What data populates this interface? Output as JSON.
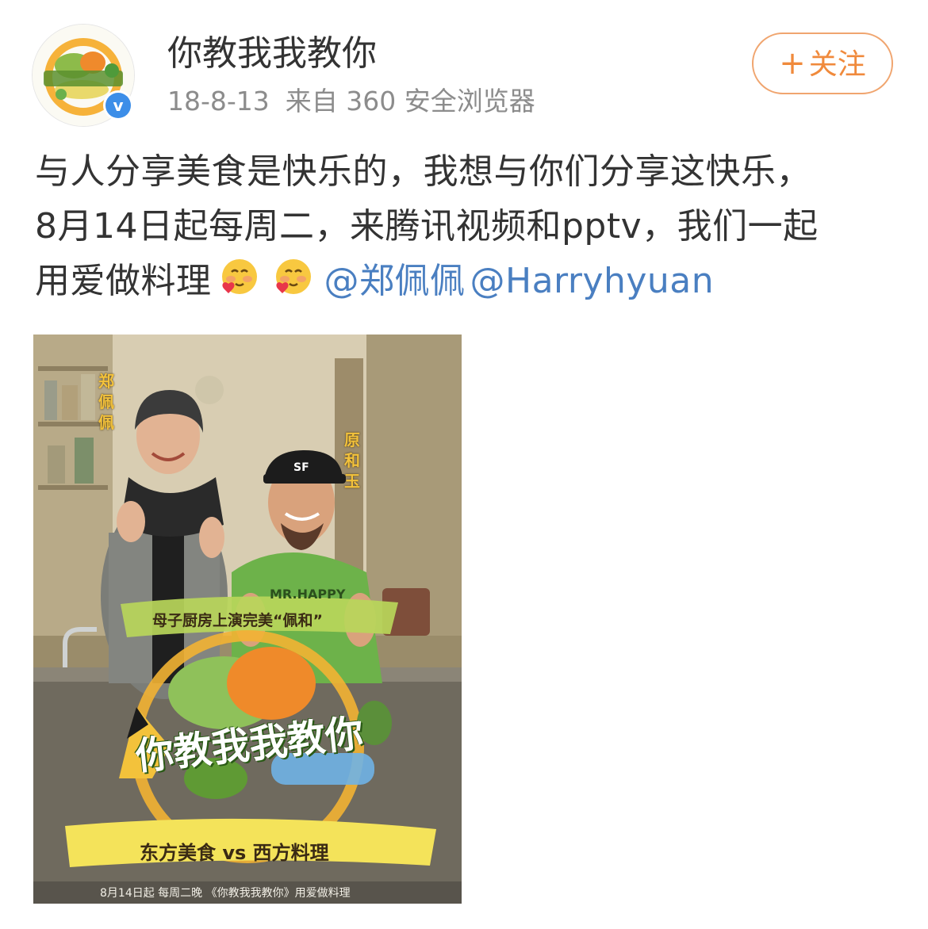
{
  "account": {
    "name": "你教我我教你",
    "date": "18-8-13",
    "source": "来自 360 安全浏览器",
    "verified_mark": "v"
  },
  "follow": {
    "plus": "+",
    "label": "关注"
  },
  "post": {
    "line1": "与人分享美食是快乐的，我想与你们分享这快乐，",
    "line2": "8月14日起每周二，来腾讯视频和pptv，我们一起",
    "line3_text": "用爱做料理",
    "emoji_name": "blush-heart-emoji",
    "mentions": [
      "@郑佩佩",
      "@Harryhyuan"
    ]
  },
  "poster": {
    "name_left": "郑佩佩",
    "name_right": "原和玉",
    "cap_text": "SF",
    "shirt_text": "MR.HAPPY",
    "banner_top": "母子厨房上演完美“佩和”",
    "logo_text": "你教我我教你",
    "banner_bottom": "东方美食 vs 西方料理",
    "footer": "8月14日起 每周二晚 《你教我我教你》用爱做料理"
  },
  "colors": {
    "mention": "#4a7fc1",
    "follow_border": "#f0a56f",
    "follow_text": "#f08a3c",
    "meta_text": "#8c8c8c",
    "verified": "#3c8ee8"
  }
}
